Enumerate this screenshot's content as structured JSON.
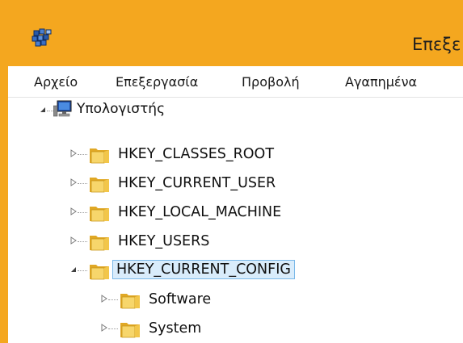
{
  "window": {
    "title": "Επεξεργασία Μητρώου",
    "visible_title": "Επεξε"
  },
  "menu": [
    {
      "label": "Αρχείο"
    },
    {
      "label": "Επεξεργασία"
    },
    {
      "label": "Προβολή"
    },
    {
      "label": "Αγαπημένα"
    }
  ],
  "tree": {
    "root": {
      "label": "Υπολογιστής",
      "icon": "computer-icon",
      "expanded": true
    },
    "hives": [
      {
        "label": "HKEY_CLASSES_ROOT",
        "expanded": false
      },
      {
        "label": "HKEY_CURRENT_USER",
        "expanded": false
      },
      {
        "label": "HKEY_LOCAL_MACHINE",
        "expanded": false
      },
      {
        "label": "HKEY_USERS",
        "expanded": false
      },
      {
        "label": "HKEY_CURRENT_CONFIG",
        "expanded": true,
        "selected": true
      }
    ],
    "children": [
      {
        "label": "Software",
        "expanded": false
      },
      {
        "label": "System",
        "expanded": false
      }
    ]
  },
  "colors": {
    "title_bar": "#f4a71f",
    "selection_bg": "#d9ecfb",
    "selection_border": "#7ab8e8",
    "folder": "#f2c64a"
  }
}
